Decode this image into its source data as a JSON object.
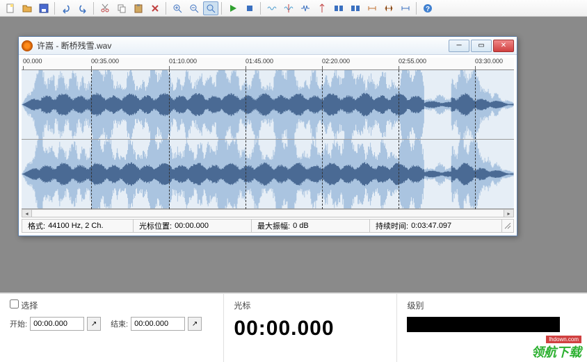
{
  "toolbar": {
    "icons": [
      "new-file",
      "open-file",
      "save-file",
      "undo",
      "redo",
      "cut",
      "copy",
      "paste",
      "delete",
      "zoom-in",
      "zoom-out",
      "zoom-select",
      "play",
      "stop",
      "wave1",
      "wave2",
      "wave3",
      "marker",
      "fade-in",
      "fade-out",
      "region1",
      "region2",
      "region3",
      "help"
    ]
  },
  "doc": {
    "title": "许嵩 - 断桥残雪.wav",
    "ruler_ticks": [
      "00.000",
      "00:35.000",
      "01:10.000",
      "01:45.000",
      "02:20.000",
      "02:55.000",
      "03:30.000"
    ]
  },
  "status": {
    "format_label": "格式:",
    "format_value": "44100 Hz, 2 Ch.",
    "cursor_label": "光标位置:",
    "cursor_value": "00:00.000",
    "amp_label": "最大振幅:",
    "amp_value": "0 dB",
    "duration_label": "持续时间:",
    "duration_value": "0:03:47.097"
  },
  "bottom": {
    "select_header_checkbox": false,
    "select_header": "选择",
    "start_label": "开始:",
    "start_value": "00:00.000",
    "end_label": "结束:",
    "end_value": "00:00.000",
    "cursor_header": "光标",
    "cursor_big": "00:00.000",
    "level_header": "级别"
  },
  "watermark": {
    "text": "领航下载",
    "url": "lhdown.com"
  },
  "colors": {
    "wave_fill": "#aac4e0",
    "wave_dark": "#4a6a94"
  }
}
